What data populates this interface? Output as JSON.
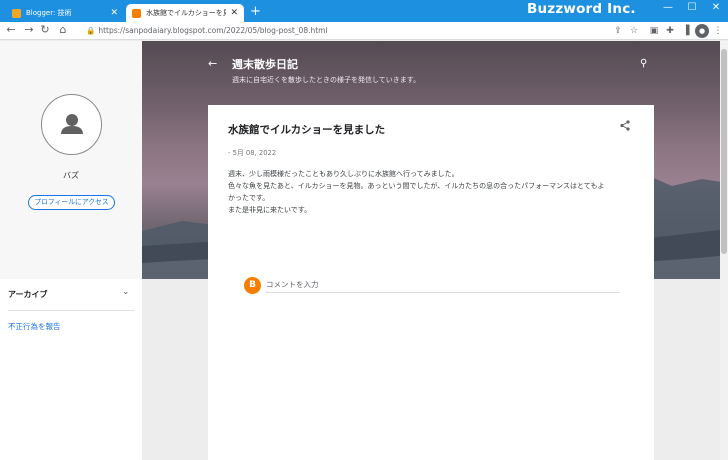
{
  "browser": {
    "tabs": [
      {
        "title": "Blogger: 技術",
        "active": false,
        "favicon_color": "#f5a623"
      },
      {
        "title": "水族館でイルカショーを見ました",
        "active": true,
        "favicon_color": "#f57d00"
      }
    ],
    "new_tab": "+",
    "brand": "Buzzword Inc.",
    "url": "https://sanpodaiary.blogspot.com/2022/05/blog-post_08.html",
    "window_controls": {
      "minimize": "—",
      "maximize": "☐",
      "close": "✕"
    }
  },
  "blog": {
    "title": "週末散歩日記",
    "description": "週末に自宅近くを散歩したときの様子を発信していきます。"
  },
  "profile": {
    "name": "バズ",
    "visit_button": "プロフィールにアクセス"
  },
  "sidebar": {
    "archive_label": "アーカイブ",
    "report_link": "不正行為を報告"
  },
  "post": {
    "title": "水族館でイルカショーを見ました",
    "date": "- 5月 08, 2022",
    "body": [
      "週末、少し雨模様だったこともあり久しぶりに水族館へ行ってみました。",
      "色々な魚を見たあと、イルカショーを見物。あっという間でしたが、イルカたちの息の合ったパフォーマンスはとてもよ",
      "かったです。",
      "また是非見に来たいです。"
    ],
    "comment_placeholder": "コメントを入力",
    "comment_avatar": "B"
  },
  "colors": {
    "chrome_blue": "#1e90e0",
    "link_blue": "#1a73e8",
    "blogger_orange": "#f57d00"
  }
}
